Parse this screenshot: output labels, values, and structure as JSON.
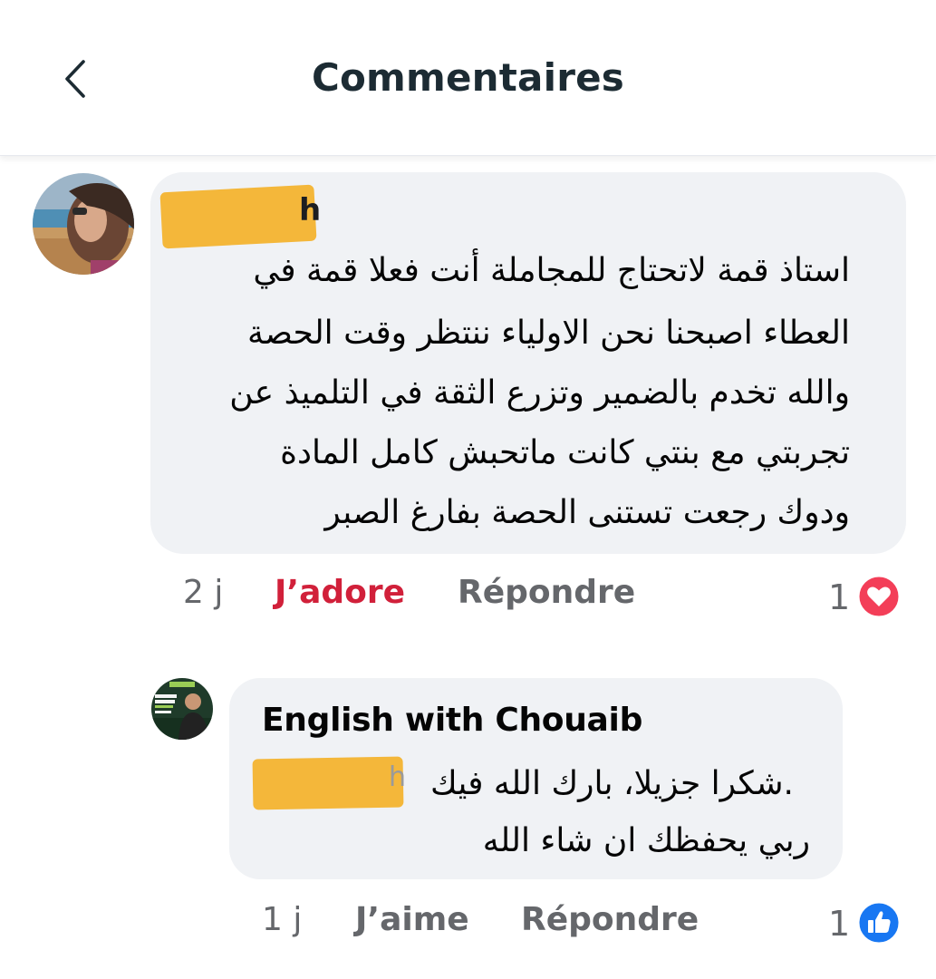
{
  "header": {
    "title": "Commentaires",
    "back_icon": "chevron-left-icon"
  },
  "comments": [
    {
      "author_visible_fragment": "h",
      "author_redacted": true,
      "lines": [
        "استاذ قمة لاتحتاج للمجاملة أنت فعلا قمة في",
        "العطاء اصبحنا نحن الاولياء ننتظر وقت الحصة",
        "والله تخدم بالضمير وتزرع الثقة في التلميذ عن",
        "تجربتي مع بنتي كانت ماتحبش كامل المادة",
        "ودوك رجعت تستنى الحصة بفارغ الصبر"
      ],
      "time": "2 j",
      "reaction_label": "J’adore",
      "reply_label": "Répondre",
      "reaction_count": "1",
      "reaction_icon": "heart-reaction-icon",
      "reaction_color": "#f33e58"
    },
    {
      "author": "English with Chouaib",
      "mention_redacted": true,
      "mention_visible_fragment": "h",
      "lines": [
        ".شكرا جزيلا، بارك الله فيك",
        "ربي يحفظك ان شاء الله"
      ],
      "time": "1 j",
      "reaction_label": "J’aime",
      "reply_label": "Répondre",
      "reaction_count": "1",
      "reaction_icon": "like-reaction-icon",
      "reaction_color": "#1877f2"
    }
  ],
  "colors": {
    "bubble_bg": "#f0f2f5",
    "redaction": "#f3b32f",
    "loved_text": "#d1203a",
    "muted_text": "#65676b"
  }
}
